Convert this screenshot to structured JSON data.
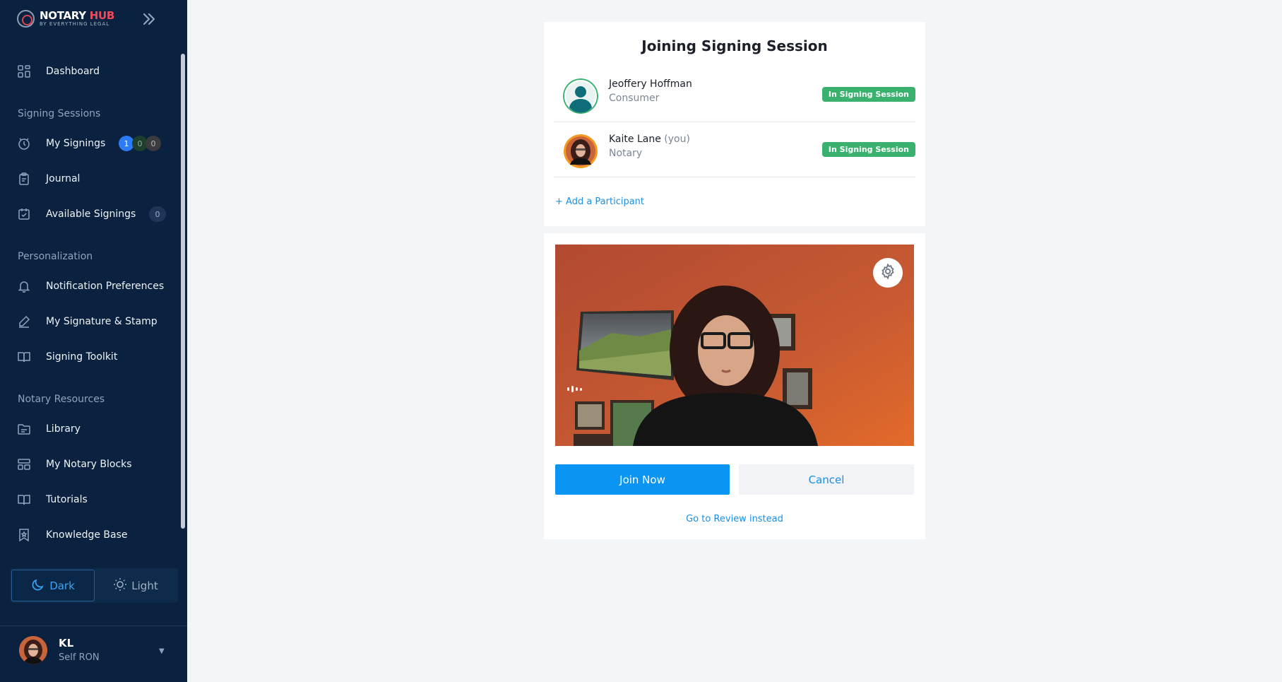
{
  "brand": {
    "name_part1": "NOTARY ",
    "name_part2": "HUB",
    "tagline": "BY EVERYTHING LEGAL"
  },
  "sidebar": {
    "dashboard": "Dashboard",
    "sections": {
      "signing": "Signing Sessions",
      "personalization": "Personalization",
      "resources": "Notary Resources"
    },
    "signing_items": {
      "my_signings": "My Signings",
      "my_signings_counts": [
        "1",
        "0",
        "0"
      ],
      "journal": "Journal",
      "available": "Available Signings",
      "available_count": "0"
    },
    "personalization_items": {
      "notifications": "Notification Preferences",
      "signature": "My Signature & Stamp",
      "toolkit": "Signing Toolkit"
    },
    "resource_items": {
      "library": "Library",
      "blocks": "My Notary Blocks",
      "tutorials": "Tutorials",
      "kb": "Knowledge Base"
    },
    "theme": {
      "dark": "Dark",
      "light": "Light",
      "selected": "Dark"
    },
    "user": {
      "initials": "KL",
      "role": "Self RON"
    }
  },
  "session": {
    "title": "Joining Signing Session",
    "participants": [
      {
        "name": "Jeoffery Hoffman",
        "you": "",
        "role": "Consumer",
        "status": "In Signing Session"
      },
      {
        "name": "Kaite Lane",
        "you": "(you)",
        "role": "Notary",
        "status": "In Signing Session"
      }
    ],
    "add_participant": "+ Add a Participant",
    "join_label": "Join Now",
    "cancel_label": "Cancel",
    "review_link": "Go to Review instead"
  },
  "colors": {
    "sidebar_bg": "#0a2240",
    "accent_blue": "#0a95f2",
    "status_green": "#3bb16f",
    "brand_red": "#ef4b5b"
  }
}
